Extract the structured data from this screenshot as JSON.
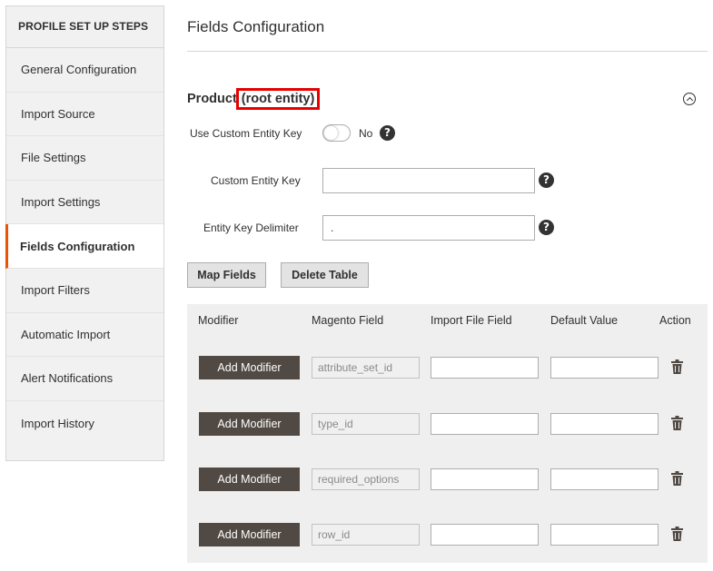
{
  "sidebar": {
    "title": "PROFILE SET UP STEPS",
    "items": [
      {
        "label": "General Configuration"
      },
      {
        "label": "Import Source"
      },
      {
        "label": "File Settings"
      },
      {
        "label": "Import Settings"
      },
      {
        "label": "Fields Configuration",
        "active": true
      },
      {
        "label": "Import Filters"
      },
      {
        "label": "Automatic Import"
      },
      {
        "label": "Alert Notifications"
      },
      {
        "label": "Import History"
      }
    ]
  },
  "page": {
    "title": "Fields Configuration"
  },
  "section": {
    "title": "Product",
    "highlighted_title": "(root entity)",
    "collapse_icon": "chevron-up-circle-icon"
  },
  "form": {
    "use_custom_key_label": "Use Custom Entity Key",
    "use_custom_key_value": "No",
    "custom_key_label": "Custom Entity Key",
    "custom_key_value": "",
    "delimiter_label": "Entity Key Delimiter",
    "delimiter_value": ".",
    "help_glyph": "?"
  },
  "buttons": {
    "map_fields": "Map Fields",
    "delete_table": "Delete Table"
  },
  "table": {
    "headers": {
      "modifier": "Modifier",
      "magento_field": "Magento Field",
      "import_file_field": "Import File Field",
      "default_value": "Default Value",
      "action": "Action"
    },
    "rows": [
      {
        "modifier_label": "Add Modifier",
        "magento_field": "attribute_set_id",
        "import_file_field": "",
        "default_value": ""
      },
      {
        "modifier_label": "Add Modifier",
        "magento_field": "type_id",
        "import_file_field": "",
        "default_value": ""
      },
      {
        "modifier_label": "Add Modifier",
        "magento_field": "required_options",
        "import_file_field": "",
        "default_value": ""
      },
      {
        "modifier_label": "Add Modifier",
        "magento_field": "row_id",
        "import_file_field": "",
        "default_value": ""
      }
    ]
  },
  "colors": {
    "accent": "#eb5202",
    "highlight_border": "#e60000",
    "dark_button": "#514943"
  }
}
